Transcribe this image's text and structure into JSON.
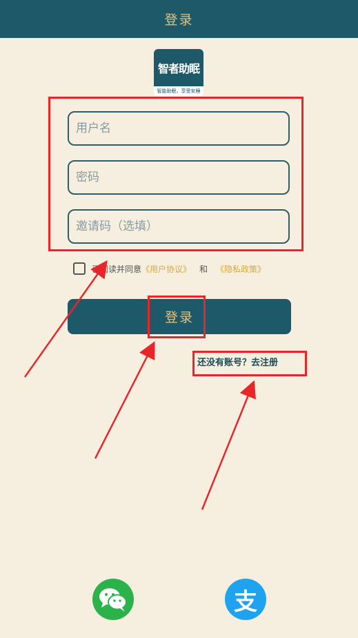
{
  "header": {
    "title": "登录"
  },
  "logo": {
    "name": "智者助眠",
    "slogan": "智能助眠，享受安睡"
  },
  "form": {
    "username_placeholder": "用户名",
    "password_placeholder": "密码",
    "invite_placeholder": "邀请码（选填）"
  },
  "agreement": {
    "prefix": "已阅读并同意",
    "user_agreement": "《用户协议》",
    "and": "和",
    "privacy_policy": "《隐私政策》"
  },
  "login_button": {
    "label": "登录"
  },
  "register_link": {
    "label": "还没有账号？去注册"
  },
  "social_login": {
    "items": [
      "wechat-icon",
      "alipay-icon"
    ],
    "alipay_glyph": "支"
  },
  "colors": {
    "primary": "#1d5968",
    "accent": "#e8c27a",
    "background": "#f6efdf",
    "annotation": "#e8262a"
  }
}
